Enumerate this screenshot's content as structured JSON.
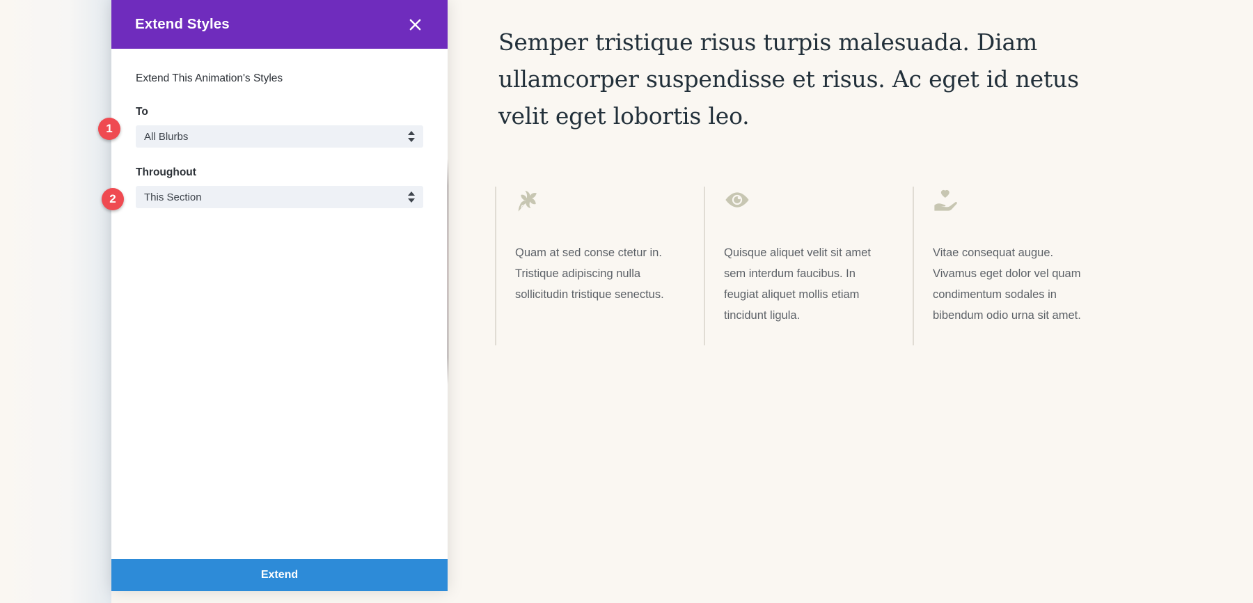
{
  "colors": {
    "modal_header": "#6f2cbd",
    "primary_button": "#2d8bd8",
    "badge": "#ef4a51",
    "page_background": "#faf7f2",
    "select_background": "#eef1f6",
    "icon": "#c7c6b2"
  },
  "modal": {
    "title": "Extend Styles",
    "close_icon": "close-icon",
    "section_label": "Extend This Animation's Styles",
    "fields": [
      {
        "label": "To",
        "value": "All Blurbs",
        "icon": "select-arrows-icon"
      },
      {
        "label": "Throughout",
        "value": "This Section",
        "icon": "select-arrows-icon"
      }
    ],
    "submit_label": "Extend"
  },
  "callouts": [
    {
      "number": "1"
    },
    {
      "number": "2"
    }
  ],
  "content": {
    "heading": "Semper tristique risus turpis malesuada. Diam ullamcorper suspendisse et risus. Ac eget id netus velit eget lobortis leo.",
    "blurbs": [
      {
        "icon": "leaf-icon",
        "text": "Quam at sed conse ctetur in. Tristique adipiscing nulla sollicitudin tristique senectus."
      },
      {
        "icon": "eye-icon",
        "text": "Quisque aliquet velit sit amet sem interdum faucibus. In feugiat aliquet mollis etiam tincidunt ligula."
      },
      {
        "icon": "heart-in-hand-icon",
        "text": "Vitae consequat augue. Vivamus eget dolor vel quam condimentum sodales in bibendum odio urna sit amet."
      }
    ]
  }
}
